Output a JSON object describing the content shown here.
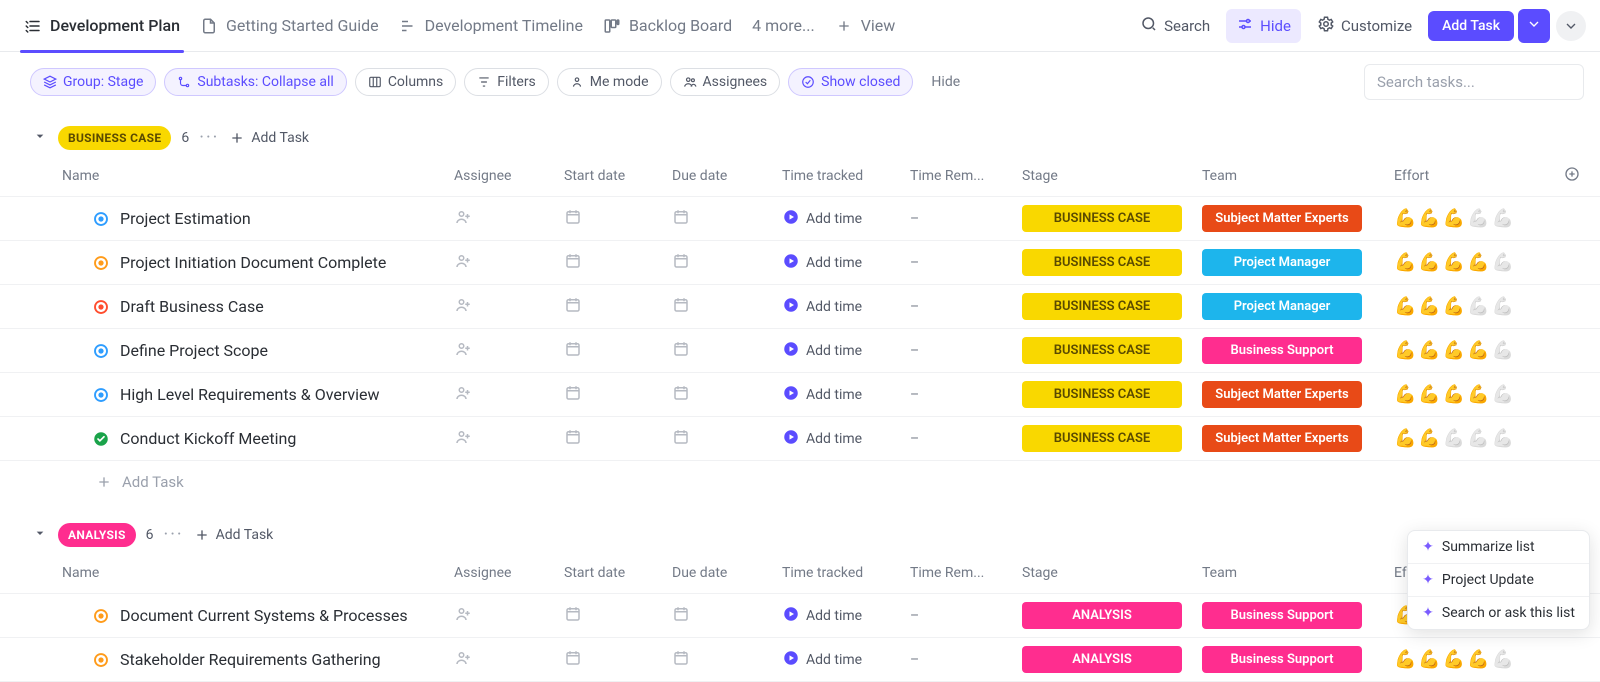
{
  "tabs": [
    {
      "label": "Development Plan",
      "icon": "list-tree-icon",
      "active": true
    },
    {
      "label": "Getting Started Guide",
      "icon": "doc-icon"
    },
    {
      "label": "Development Timeline",
      "icon": "timeline-icon"
    },
    {
      "label": "Backlog Board",
      "icon": "board-icon"
    },
    {
      "label": "4 more...",
      "more": true
    },
    {
      "label": "View",
      "add": true
    }
  ],
  "toolbar": {
    "search": "Search",
    "hide": "Hide",
    "customize": "Customize",
    "add_task": "Add Task"
  },
  "filters": {
    "group": "Group: Stage",
    "subtasks": "Subtasks: Collapse all",
    "columns": "Columns",
    "filters": "Filters",
    "me_mode": "Me mode",
    "assignees": "Assignees",
    "show_closed": "Show closed",
    "hide": "Hide"
  },
  "search_placeholder": "Search tasks...",
  "columns": {
    "name": "Name",
    "assignee": "Assignee",
    "start_date": "Start date",
    "due_date": "Due date",
    "time_tracked": "Time tracked",
    "time_remaining": "Time Rem...",
    "stage": "Stage",
    "team": "Team",
    "effort": "Effort"
  },
  "common": {
    "add_time": "Add time",
    "dash": "–",
    "add_task": "Add Task",
    "add_task_placeholder": "Add Task"
  },
  "groups": [
    {
      "name": "BUSINESS CASE",
      "tag_class": "tag-yellow",
      "stage_class": "b-stage-yellow",
      "count": 6,
      "tasks": [
        {
          "name": "Project Estimation",
          "status": "open-blue",
          "stage": "BUSINESS CASE",
          "team": "Subject Matter Experts",
          "team_class": "b-team-orange",
          "effort": 3
        },
        {
          "name": "Project Initiation Document Complete",
          "status": "open-orange",
          "stage": "BUSINESS CASE",
          "team": "Project Manager",
          "team_class": "b-team-blue",
          "effort": 4
        },
        {
          "name": "Draft Business Case",
          "status": "open-red",
          "stage": "BUSINESS CASE",
          "team": "Project Manager",
          "team_class": "b-team-blue",
          "effort": 3
        },
        {
          "name": "Define Project Scope",
          "status": "open-blue",
          "stage": "BUSINESS CASE",
          "team": "Business Support",
          "team_class": "b-team-pink",
          "effort": 4
        },
        {
          "name": "High Level Requirements & Overview",
          "status": "open-blue",
          "stage": "BUSINESS CASE",
          "team": "Subject Matter Experts",
          "team_class": "b-team-orange",
          "effort": 4
        },
        {
          "name": "Conduct Kickoff Meeting",
          "status": "done-green",
          "stage": "BUSINESS CASE",
          "team": "Subject Matter Experts",
          "team_class": "b-team-orange",
          "effort": 2
        }
      ]
    },
    {
      "name": "ANALYSIS",
      "tag_class": "tag-pink",
      "stage_class": "b-stage-pink",
      "count": 6,
      "tasks": [
        {
          "name": "Document Current Systems & Processes",
          "status": "open-orange",
          "stage": "ANALYSIS",
          "team": "Business Support",
          "team_class": "b-team-pink",
          "effort": 4
        },
        {
          "name": "Stakeholder Requirements Gathering",
          "status": "open-orange",
          "stage": "ANALYSIS",
          "team": "Business Support",
          "team_class": "b-team-pink",
          "effort": 4
        }
      ]
    }
  ],
  "float": {
    "summarize": "Summarize list",
    "update": "Project Update",
    "ask": "Search or ask this list"
  }
}
